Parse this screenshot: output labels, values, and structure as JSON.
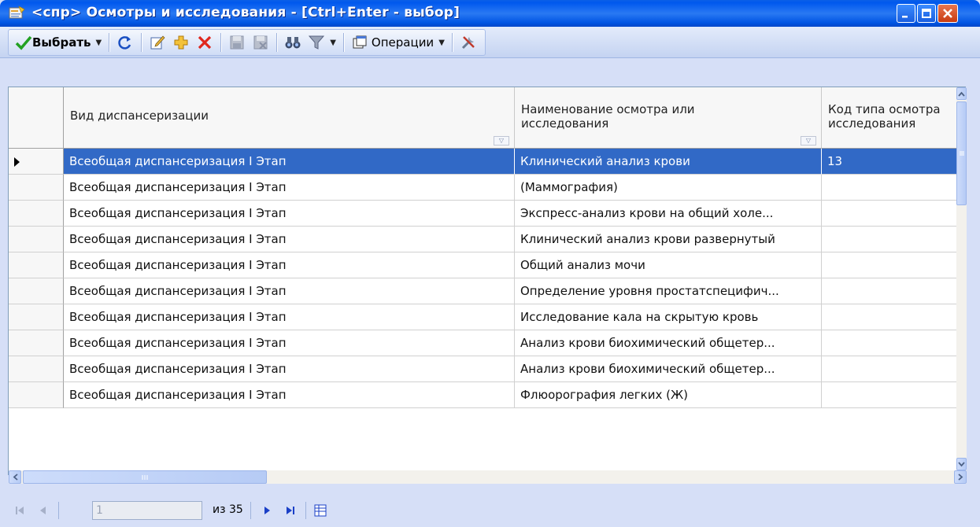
{
  "window": {
    "title": "<спр> Осмотры и исследования - [Ctrl+Enter - выбор]",
    "minimize_glyph": "_",
    "maximize_glyph": "□",
    "close_glyph": "✕"
  },
  "toolbar": {
    "select_label": "Выбрать",
    "operations_label": "Операции",
    "icons": [
      "refresh-icon",
      "edit-icon",
      "add-icon",
      "delete-icon",
      "save-icon",
      "cancel-save-icon",
      "find-icon",
      "filter-icon",
      "operations-icon",
      "tools-icon"
    ]
  },
  "grid": {
    "columns": [
      {
        "label": "Вид диспансеризации",
        "filter": "▽"
      },
      {
        "label_line1": "Наименование осмотра или",
        "label_line2": "исследования",
        "filter": "▽"
      },
      {
        "label_line1": "Код типа осмотра",
        "label_line2": "исследования"
      }
    ],
    "rows": [
      {
        "type": "Всеобщая диспансеризация I Этап",
        "name": "Клинический анализ крови",
        "code": "13",
        "selected": true
      },
      {
        "type": "Всеобщая диспансеризация I Этап",
        "name": "(Маммография)",
        "code": ""
      },
      {
        "type": "Всеобщая диспансеризация I Этап",
        "name": "Экспресс-анализ крови на общий холе...",
        "code": ""
      },
      {
        "type": "Всеобщая диспансеризация I Этап",
        "name": "Клинический анализ крови развернутый",
        "code": ""
      },
      {
        "type": "Всеобщая диспансеризация I Этап",
        "name": "Общий анализ мочи",
        "code": ""
      },
      {
        "type": "Всеобщая диспансеризация I Этап",
        "name": "Определение уровня простатспецифич...",
        "code": ""
      },
      {
        "type": "Всеобщая диспансеризация I Этап",
        "name": "Исследование кала на скрытую кровь",
        "code": ""
      },
      {
        "type": "Всеобщая диспансеризация I Этап",
        "name": "Анализ крови биохимический общетер...",
        "code": ""
      },
      {
        "type": "Всеобщая диспансеризация I Этап",
        "name": "Анализ крови биохимический общетер...",
        "code": ""
      },
      {
        "type": "Всеобщая диспансеризация I Этап",
        "name": "Флюорография легких (Ж)",
        "code": ""
      }
    ]
  },
  "navigator": {
    "current_page": "1",
    "total_label": "из 35"
  },
  "colors": {
    "selection": "#3169c6",
    "titlebar": "#0058ee"
  }
}
